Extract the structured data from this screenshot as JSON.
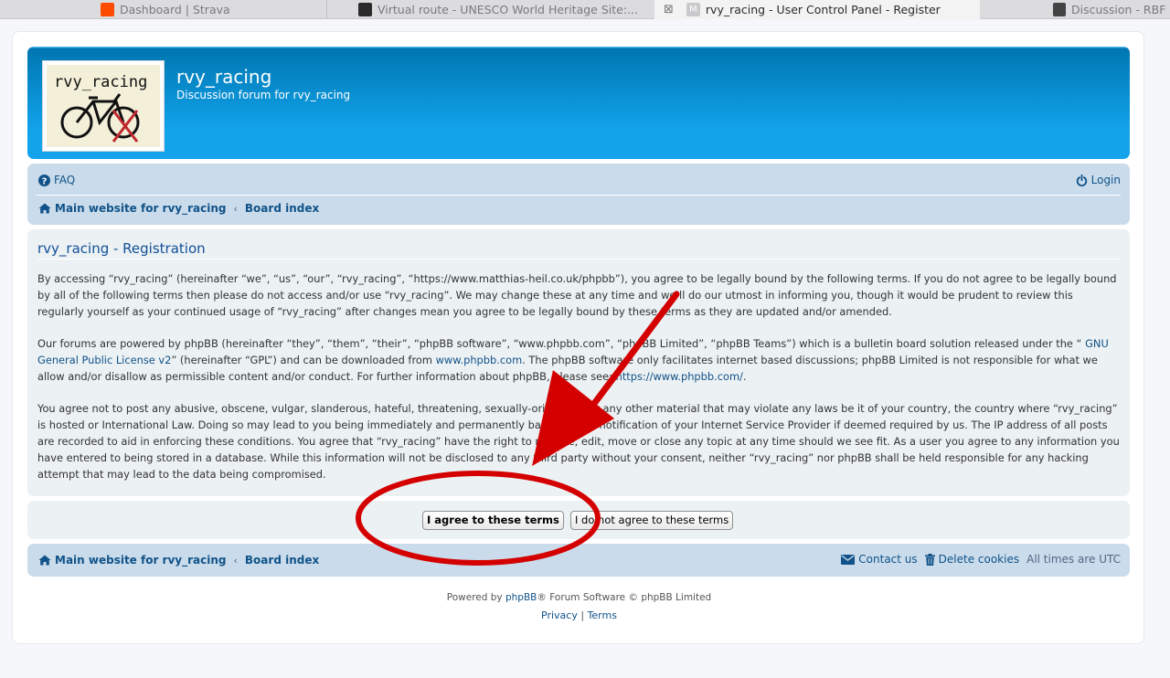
{
  "tabs": [
    {
      "title": "Dashboard | Strava",
      "favicon_color": "#fc4c02"
    },
    {
      "title": "Virtual route - UNESCO World Heritage Site:...",
      "favicon_color": "#2b2b2b"
    },
    {
      "title": "rvy_racing - User Control Panel - Register",
      "favicon_color": "#c9c9cc",
      "close_glyph": "⊠",
      "favicon_letter": "M"
    },
    {
      "title": "Discussion - RBF",
      "favicon_color": "#444444"
    }
  ],
  "header": {
    "logo_text": "rvy_racing",
    "site_title": "rvy_racing",
    "site_description": "Discussion forum for rvy_racing"
  },
  "navbar": {
    "faq": "FAQ",
    "login": "Login",
    "breadcrumb_home": "Main website for rvy_racing",
    "breadcrumb_sep": "‹",
    "breadcrumb_board": "Board index"
  },
  "registration": {
    "title": "rvy_racing - Registration",
    "para1": "By accessing “rvy_racing” (hereinafter “we”, “us”, “our”, “rvy_racing”, “https://www.matthias-heil.co.uk/phpbb”), you agree to be legally bound by the following terms. If you do not agree to be legally bound by all of the following terms then please do not access and/or use “rvy_racing”. We may change these at any time and we’ll do our utmost in informing you, though it would be prudent to review this regularly yourself as your continued usage of “rvy_racing” after changes mean you agree to be legally bound by these terms as they are updated and/or amended.",
    "para2_a": "Our forums are powered by phpBB (hereinafter “they”, “them”, “their”, “phpBB software”, “www.phpbb.com”, “phpBB Limited”, “phpBB Teams”) which is a bulletin board solution released under the “ ",
    "para2_link_gpl": "GNU General Public License v2",
    "para2_b": "” (hereinafter “GPL”) and can be downloaded from ",
    "para2_link_site": "www.phpbb.com",
    "para2_c": ". The phpBB software only facilitates internet based discussions; phpBB Limited is not responsible for what we allow and/or disallow as permissible content and/or conduct. For further information about phpBB, please see: ",
    "para2_link_url": "https://www.phpbb.com/",
    "para2_d": ".",
    "para3": "You agree not to post any abusive, obscene, vulgar, slanderous, hateful, threatening, sexually-orientated or any other material that may violate any laws be it of your country, the country where “rvy_racing” is hosted or International Law. Doing so may lead to you being immediately and permanently banned, with notification of your Internet Service Provider if deemed required by us. The IP address of all posts are recorded to aid in enforcing these conditions. You agree that “rvy_racing” have the right to remove, edit, move or close any topic at any time should we see fit. As a user you agree to any information you have entered to being stored in a database. While this information will not be disclosed to any third party without your consent, neither “rvy_racing” nor phpBB shall be held responsible for any hacking attempt that may lead to the data being compromised.",
    "agree_button": "I agree to these terms",
    "disagree_button": "I do not agree to these terms"
  },
  "footer": {
    "breadcrumb_home": "Main website for rvy_racing",
    "breadcrumb_board": "Board index",
    "contact": "Contact us",
    "delete_cookies": "Delete cookies",
    "timezone": "All times are UTC",
    "powered_prefix": "Powered by ",
    "powered_link": "phpBB",
    "powered_suffix": "® Forum Software © phpBB Limited",
    "privacy": "Privacy",
    "separator": "|",
    "terms": "Terms"
  },
  "colors": {
    "link": "#105289",
    "header_blue": "#12a3eb",
    "panel_bg": "#ecf1f3",
    "nav_bg": "#cadceb",
    "annotation_red": "#d40000"
  }
}
